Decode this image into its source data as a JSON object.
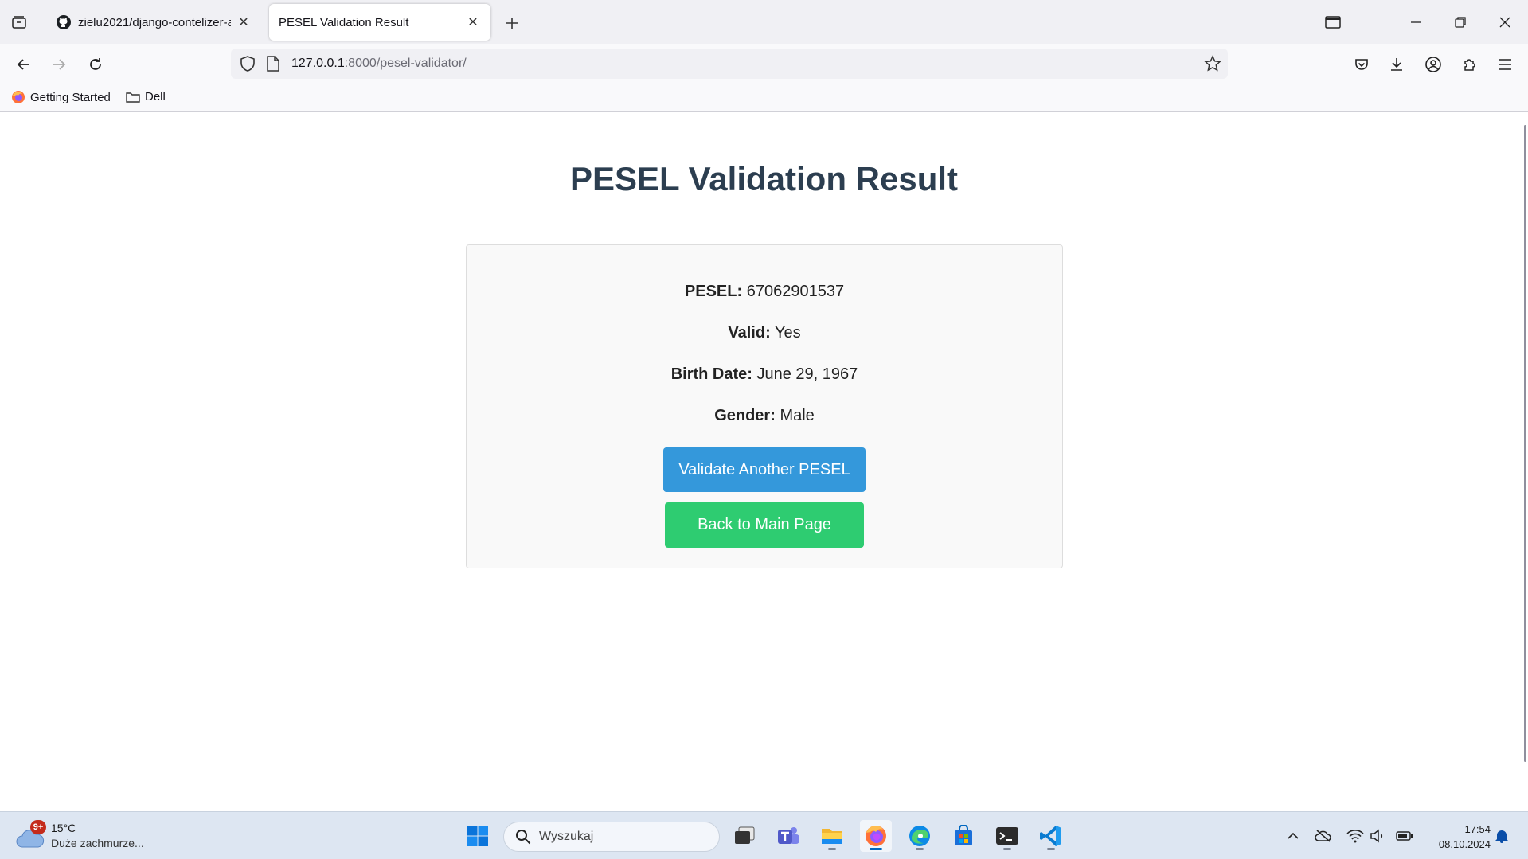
{
  "browser": {
    "tabs": [
      {
        "title": "zielu2021/django-contelizer-ap",
        "favicon": "github-icon"
      },
      {
        "title": "PESEL Validation Result",
        "favicon": "none"
      }
    ],
    "url_host": "127.0.0.1",
    "url_rest": ":8000/pesel-validator/",
    "bookmarks": [
      {
        "label": "Getting Started",
        "icon": "firefox-icon"
      },
      {
        "label": "Dell",
        "icon": "folder-icon"
      }
    ]
  },
  "page": {
    "title": "PESEL Validation Result",
    "fields": [
      {
        "label": "PESEL:",
        "value": "67062901537"
      },
      {
        "label": "Valid:",
        "value": "Yes"
      },
      {
        "label": "Birth Date:",
        "value": "June 29, 1967"
      },
      {
        "label": "Gender:",
        "value": "Male"
      }
    ],
    "buttons": {
      "validate_another": "Validate Another PESEL",
      "back_main": "Back to Main Page"
    },
    "colors": {
      "title": "#2c3e50",
      "primary_button": "#3498db",
      "secondary_button": "#2ecc71",
      "card_bg": "#f9f9f9"
    }
  },
  "taskbar": {
    "weather_badge": "9+",
    "temperature": "15°C",
    "weather_desc": "Duże zachmurze...",
    "search_placeholder": "Wyszukaj",
    "time": "17:54",
    "date": "08.10.2024"
  }
}
